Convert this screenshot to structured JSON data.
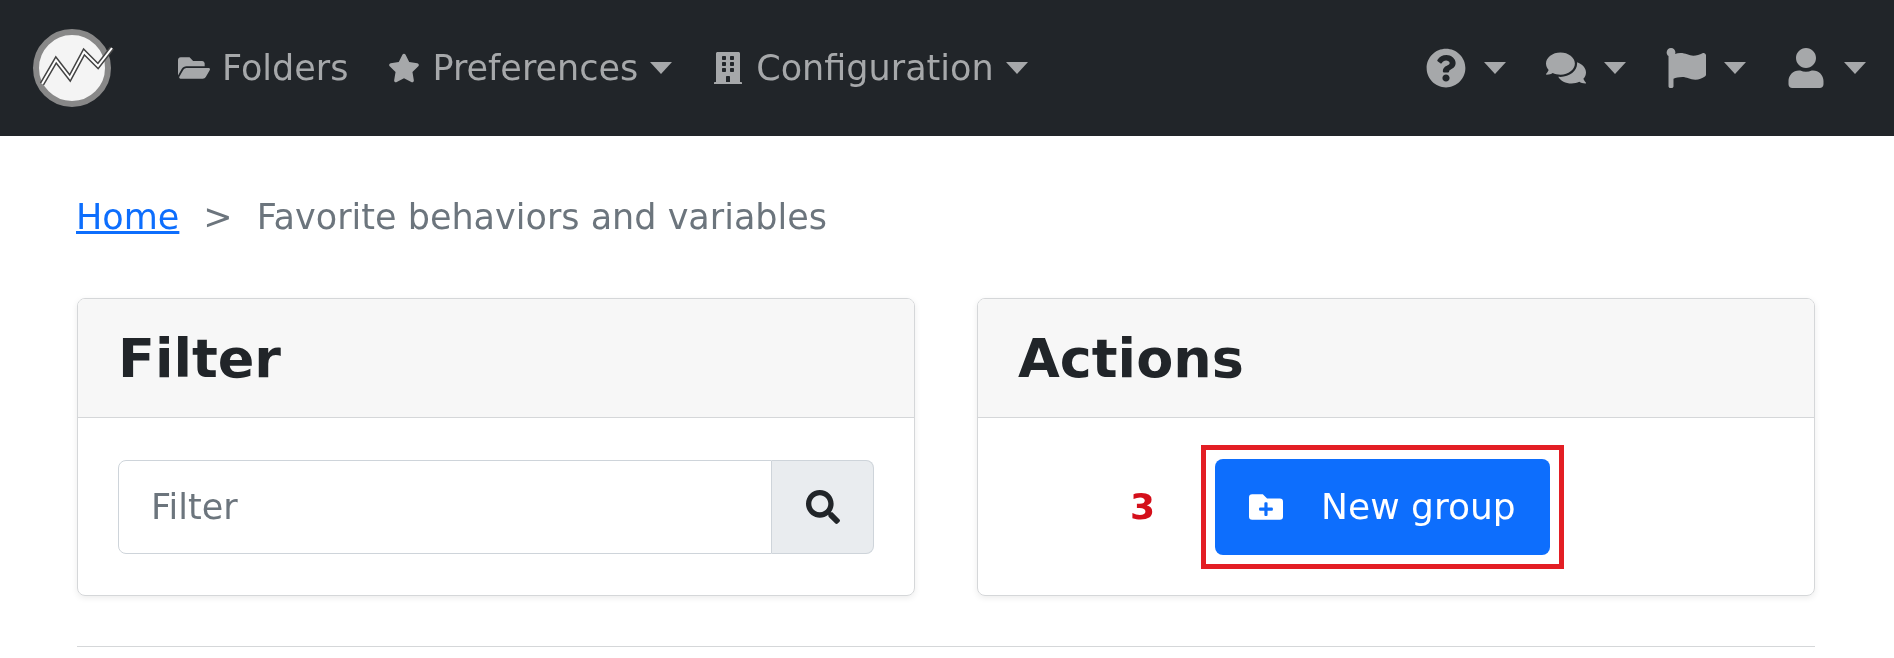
{
  "navbar": {
    "items": [
      {
        "label": "Folders",
        "dropdown": false
      },
      {
        "label": "Preferences",
        "dropdown": true
      },
      {
        "label": "Configuration",
        "dropdown": true
      }
    ],
    "right_items": [
      {
        "dropdown": true
      },
      {
        "dropdown": true
      },
      {
        "dropdown": true
      },
      {
        "dropdown": true
      }
    ]
  },
  "breadcrumb": {
    "link": "Home",
    "separator": ">",
    "current": "Favorite behaviors and variables"
  },
  "filter_card": {
    "title": "Filter",
    "search": {
      "placeholder": "Filter"
    }
  },
  "actions_card": {
    "title": "Actions",
    "button": {
      "label": "New group",
      "highlighted": true
    },
    "annotation": "3"
  }
}
